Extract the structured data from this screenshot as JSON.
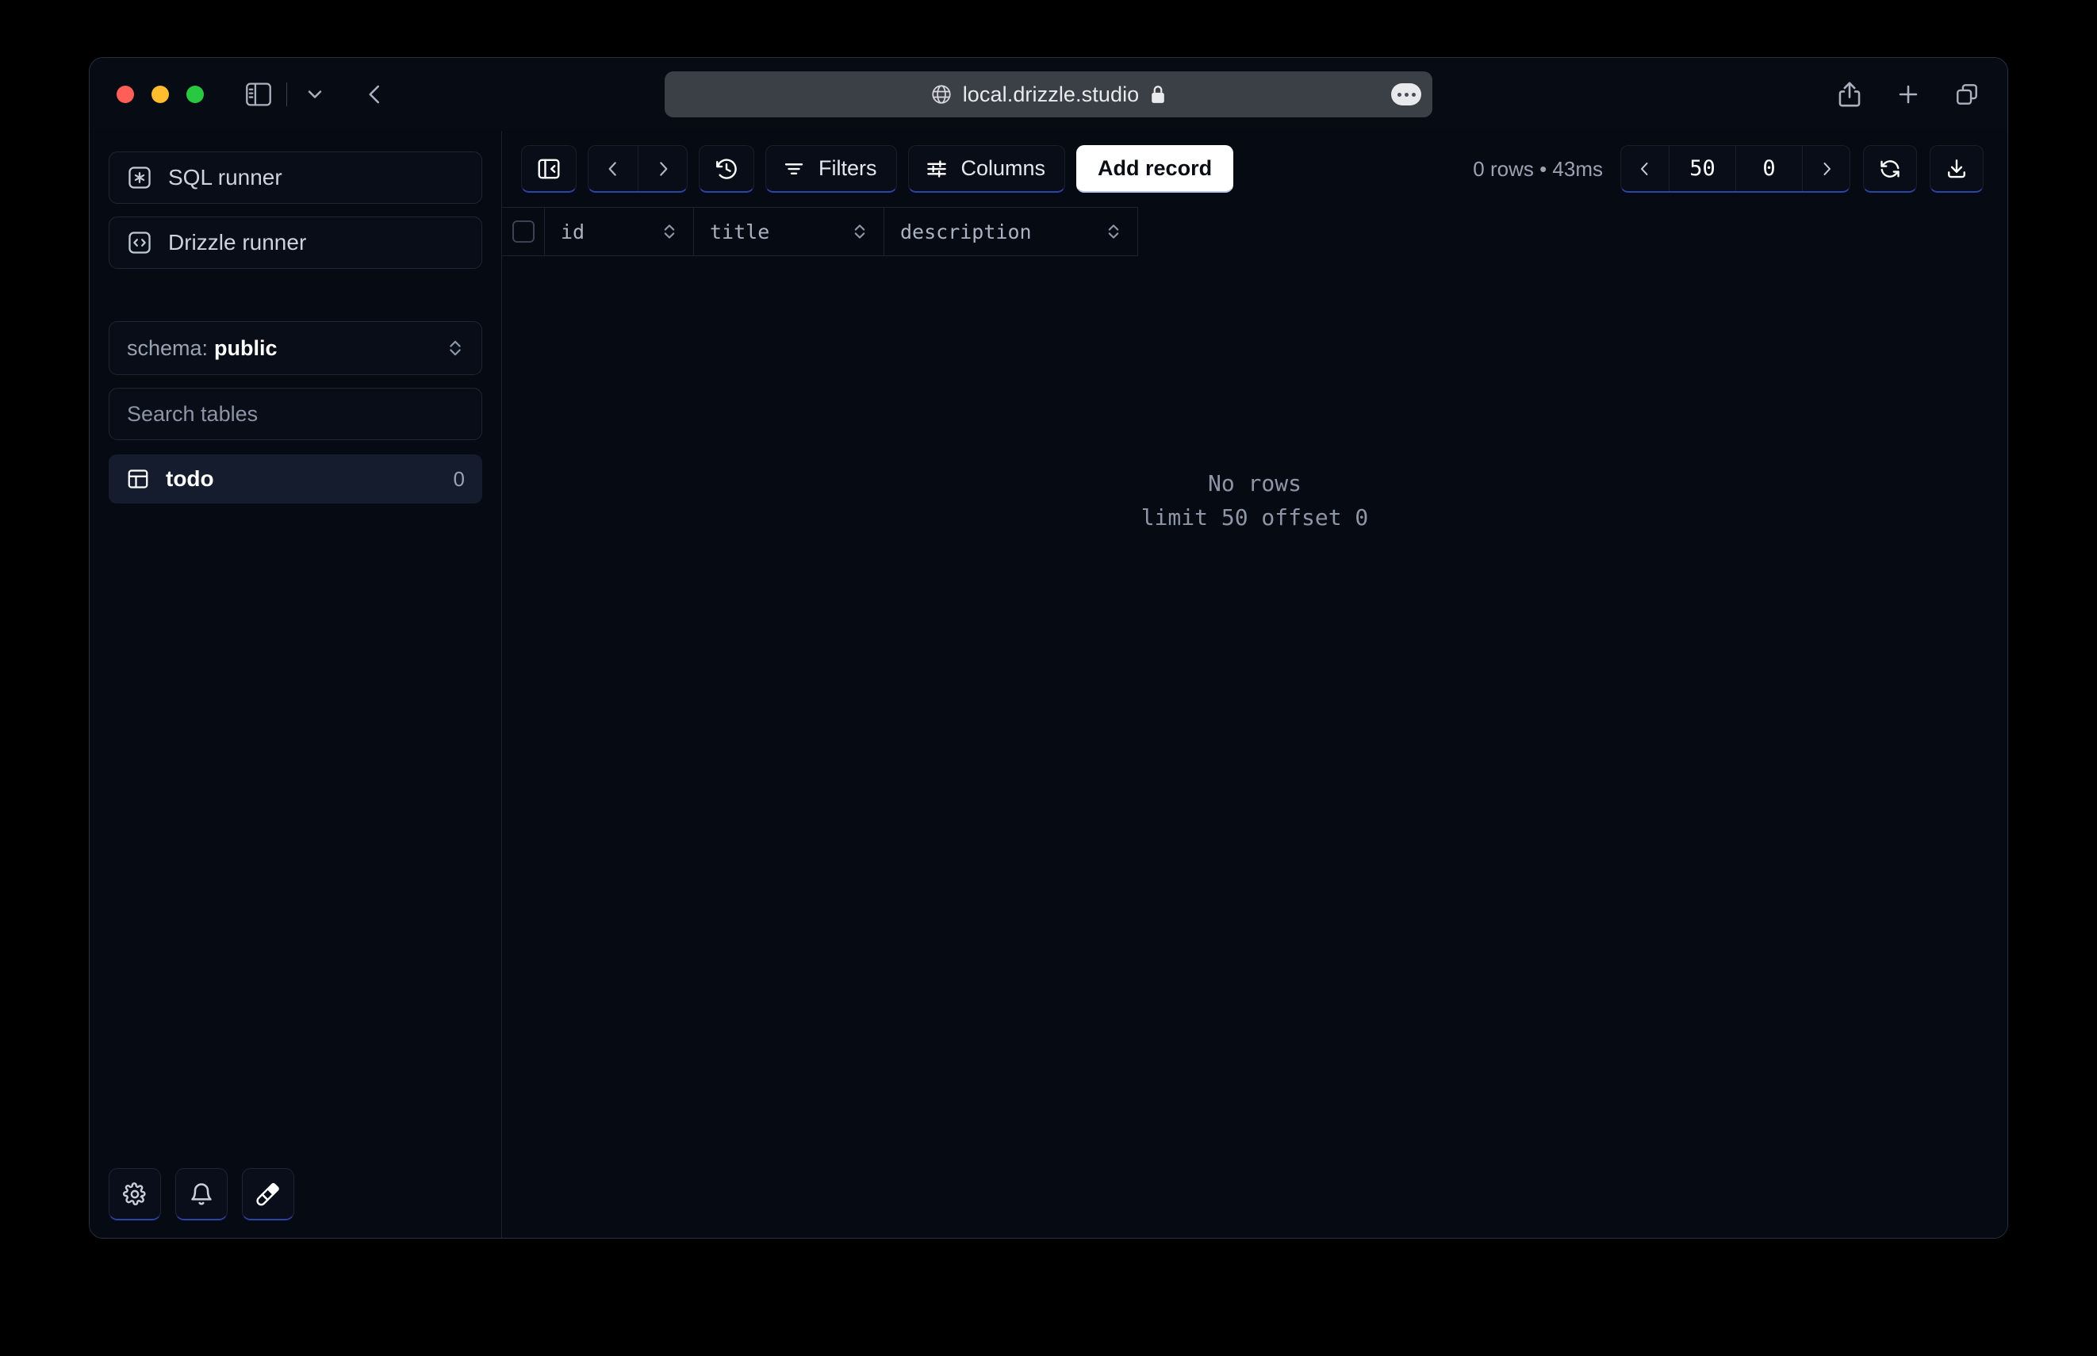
{
  "browser": {
    "traffic_lights": [
      "close",
      "minimize",
      "zoom"
    ],
    "sidebar_toggle_icon": "sidebar-icon",
    "tab_overview_chevron_icon": "chevron-down-icon",
    "back_icon": "chevron-left-icon",
    "address": {
      "globe_icon": "globe-icon",
      "url": "local.drizzle.studio",
      "lock_icon": "lock-icon",
      "more_icon": "ellipsis-icon"
    },
    "right_tools": [
      {
        "name": "share-button",
        "icon": "share-icon"
      },
      {
        "name": "new-tab-button",
        "icon": "plus-icon"
      },
      {
        "name": "tab-overview-button",
        "icon": "copy-icon"
      }
    ]
  },
  "sidebar": {
    "runners": [
      {
        "label": "SQL runner",
        "icon": "asterisk-box-icon"
      },
      {
        "label": "Drizzle runner",
        "icon": "code-box-icon"
      }
    ],
    "schema": {
      "label": "schema:",
      "value": "public",
      "chevron_icon": "chevron-updown-icon"
    },
    "search": {
      "placeholder": "Search tables",
      "value": ""
    },
    "tables": [
      {
        "name": "todo",
        "count": "0",
        "icon": "table-icon",
        "selected": true
      }
    ],
    "footer": [
      {
        "name": "settings-button",
        "icon": "gear-icon"
      },
      {
        "name": "notifications-button",
        "icon": "bell-icon"
      },
      {
        "name": "theme-button",
        "icon": "paintbrush-icon"
      }
    ]
  },
  "toolbar": {
    "collapse_panel_icon": "panel-collapse-icon",
    "nav_back_icon": "chevron-left-icon",
    "nav_forward_icon": "chevron-right-icon",
    "history_icon": "history-clock-icon",
    "filters_label": "Filters",
    "filters_icon": "filter-icon",
    "columns_label": "Columns",
    "columns_icon": "sliders-icon",
    "add_record_label": "Add record",
    "rows_info": "0 rows • 43ms",
    "pager": {
      "prev_icon": "chevron-left-icon",
      "limit": "50",
      "offset": "0",
      "next_icon": "chevron-right-icon"
    },
    "refresh_icon": "refresh-icon",
    "download_icon": "download-icon"
  },
  "table": {
    "select_all": false,
    "columns": [
      {
        "label": "id",
        "sort_icon": "sort-icon"
      },
      {
        "label": "title",
        "sort_icon": "sort-icon"
      },
      {
        "label": "description",
        "sort_icon": "sort-icon"
      }
    ],
    "rows": [],
    "empty": {
      "line1": "No rows",
      "line2": "limit 50 offset 0"
    }
  },
  "colors": {
    "page_background": "#000000",
    "window_background": "#070b14",
    "app_background": "#060a12",
    "selected_table": "#141c2e",
    "accent_blue": "#2a44a8",
    "primary_button": "#ffffff",
    "address_bar": "#3b3f46",
    "traffic_red": "#ff5f57",
    "traffic_yellow": "#febc2e",
    "traffic_green": "#28c840"
  }
}
